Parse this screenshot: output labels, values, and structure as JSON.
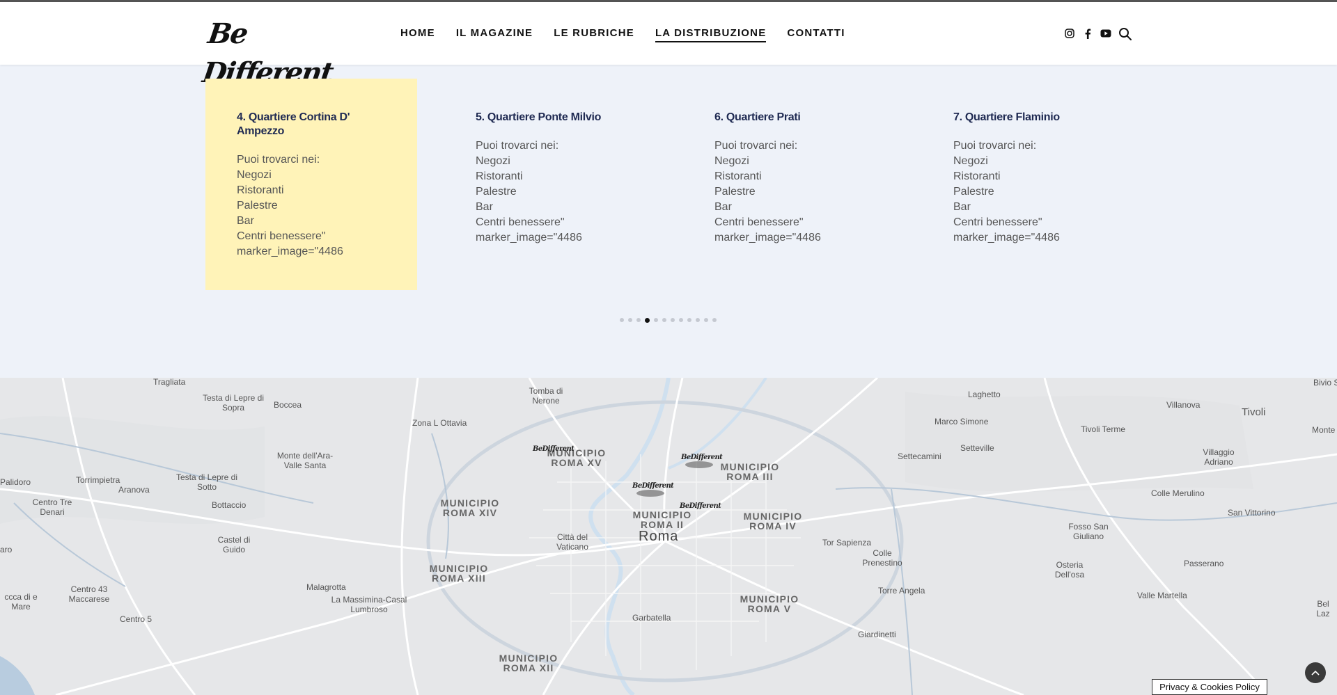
{
  "header": {
    "logo_text": "Be Different",
    "nav": [
      "HOME",
      "IL MAGAZINE",
      "LE RUBRICHE",
      "LA DISTRIBUZIONE",
      "CONTATTI"
    ],
    "active_nav": "LA DISTRIBUZIONE",
    "social_icons": [
      "instagram-icon",
      "facebook-icon",
      "youtube-icon"
    ],
    "search_icon": "search-icon"
  },
  "cards": [
    {
      "title": "4. Quartiere Cortina D' Ampezzo",
      "highlight": true,
      "lines": [
        "Puoi trovarci nei:",
        "Negozi",
        "Ristoranti",
        "Palestre",
        "Bar",
        "Centri benessere\"",
        "marker_image=\"4486"
      ]
    },
    {
      "title": "5. Quartiere Ponte Milvio",
      "highlight": false,
      "lines": [
        "Puoi trovarci nei:",
        "Negozi",
        "Ristoranti",
        "Palestre",
        "Bar",
        "Centri benessere\"",
        "marker_image=\"4486"
      ]
    },
    {
      "title": "6. Quartiere Prati",
      "highlight": false,
      "lines": [
        "Puoi trovarci nei:",
        "Negozi",
        "Ristoranti",
        "Palestre",
        "Bar",
        "Centri benessere\"",
        "marker_image=\"4486"
      ]
    },
    {
      "title": "7. Quartiere Flaminio",
      "highlight": false,
      "lines": [
        "Puoi trovarci nei:",
        "Negozi",
        "Ristoranti",
        "Palestre",
        "Bar",
        "Centri benessere\"",
        "marker_image=\"4486"
      ]
    }
  ],
  "carousel": {
    "total": 12,
    "active_index": 3
  },
  "map": {
    "labels": [
      "Tragliata",
      "Testa di Lepre di Sopra",
      "Boccea",
      "Tomba di Nerone",
      "Zona L Ottavia",
      "Laghetto",
      "Bivio Sa",
      "Marco Simone",
      "Villanova",
      "Tivoli",
      "Tivoli Terme",
      "Monte",
      "Setteville",
      "Settecamini",
      "Villaggio Adriano",
      "Monte dell'Ara-Valle Santa",
      "Torrimpietra",
      "Testa di Lepre di Sotto",
      "Aranova",
      "Palidoro",
      "Centro Tre Denari",
      "Bottaccio",
      "Colle Merulino",
      "San Vittorino",
      "Fosso San Giuliano",
      "Città del Vaticano",
      "Roma",
      "Tor Sapienza",
      "Colle Prenestino",
      "Osteria Dell'osa",
      "Passerano",
      "Castel di Guido",
      "Malagrotta",
      "Centro 43 Maccarese",
      "La Massimina-Casal Lumbroso",
      "Torre Angela",
      "Valle Martella",
      "Bel Laz",
      "Centro 5",
      "Garbatella",
      "Giardinetti",
      "ccca di e Mare",
      "aro"
    ],
    "municipi": [
      "MUNICIPIO ROMA XV",
      "MUNICIPIO ROMA III",
      "MUNICIPIO ROMA XIV",
      "MUNICIPIO ROMA II",
      "MUNICIPIO ROMA IV",
      "MUNICIPIO ROMA XIII",
      "MUNICIPIO ROMA V",
      "MUNICIPIO ROMA XII"
    ],
    "marker_logo": "BeDifferent"
  },
  "footer": {
    "privacy": "Privacy & Cookies Policy",
    "scroll_top_icon": "chevron-up-icon"
  },
  "colors": {
    "highlight": "#fff3b8",
    "title": "#1f2a52",
    "band": "#eef2f9",
    "map_bg": "#e6e7e9"
  }
}
